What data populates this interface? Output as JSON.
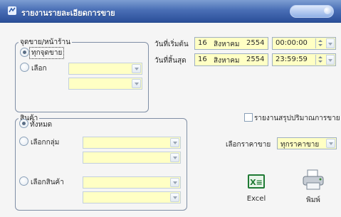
{
  "window": {
    "title": "รายงานรายละเอียดการขาย"
  },
  "branch_group": {
    "legend": "จุดขาย/หน้าร้าน",
    "options": [
      "ทุกจุดขาย",
      "เลือก"
    ],
    "selected_index": 0
  },
  "date_range": {
    "start_label": "วันที่เริ่มต้น",
    "end_label": "วันที่สิ้นสุด",
    "start": {
      "day": "16",
      "month": "สิงหาคม",
      "year": "2554",
      "time": "00:00:00"
    },
    "end": {
      "day": "16",
      "month": "สิงหาคม",
      "year": "2554",
      "time": "23:59:59"
    }
  },
  "product_group": {
    "legend": "สินค้า",
    "options": [
      "ทั้งหมด",
      "เลือกกลุ่ม",
      "เลือกสินค้า"
    ],
    "selected_index": 0
  },
  "summary_checkbox": {
    "label": "รายงานสรุปปริมาณการขาย",
    "checked": false
  },
  "price": {
    "label": "เลือกราคาขาย",
    "value": "ทุกราคาขาย"
  },
  "actions": {
    "excel_label": "Excel",
    "excel_icon_text": "X≡",
    "print_label": "พิมพ์"
  },
  "colors": {
    "field_bg": "#ffffc4",
    "titlebar": "#4a6fb6"
  }
}
